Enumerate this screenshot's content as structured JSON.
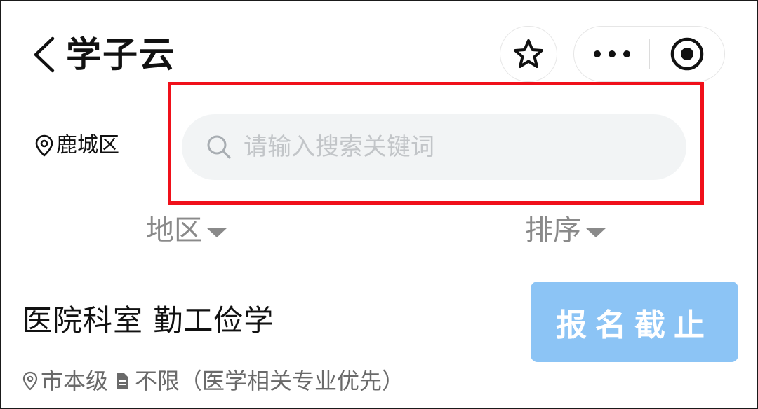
{
  "header": {
    "title": "学子云",
    "icons": {
      "back": "chevron-left-icon",
      "favorite": "star-icon",
      "more": "more-dots-icon",
      "close": "close-circle-icon"
    }
  },
  "location": {
    "icon": "location-pin-icon",
    "label": "鹿城区"
  },
  "search": {
    "placeholder": "请输入搜索关键词",
    "value": "",
    "icon": "search-icon",
    "highlight_color": "#f0101a"
  },
  "filters": [
    {
      "label": "地区",
      "icon": "caret-down-icon"
    },
    {
      "label": "排序",
      "icon": "caret-down-icon"
    }
  ],
  "listing": {
    "title": "医院科室 勤工俭学",
    "status_label": "报名截止",
    "status_color": "#8cc4f5",
    "area": "市本级",
    "requirement": "不限（医学相关专业优先）"
  }
}
